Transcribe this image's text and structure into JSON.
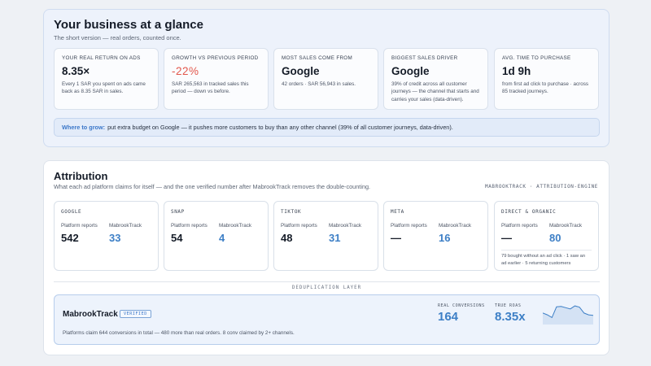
{
  "glance": {
    "title": "Your business at a glance",
    "subtitle": "The short version — real orders, counted once.",
    "kpis": [
      {
        "label": "Your real return on ads",
        "value": "8.35×",
        "desc": "Every 1 SAR you spent on ads came back as 8.35 SAR in sales."
      },
      {
        "label": "Growth vs previous period",
        "value": "-22%",
        "desc": "SAR 265,563 in tracked sales this period — down vs before."
      },
      {
        "label": "Most sales come from",
        "value": "Google",
        "desc": "42 orders · SAR 56,943 in sales."
      },
      {
        "label": "Biggest sales driver",
        "value": "Google",
        "desc": "39% of credit across all customer journeys — the channel that starts and carries your sales (data-driven)."
      },
      {
        "label": "Avg. time to purchase",
        "value": "1d 9h",
        "desc": "from first ad click to purchase · across 85 tracked journeys."
      }
    ],
    "grow": {
      "lead": "Where to grow:",
      "text": "put extra budget on Google — it pushes more customers to buy than any other channel (39% of all customer journeys, data-driven)."
    }
  },
  "attribution": {
    "title": "Attribution",
    "subtitle": "What each ad platform claims for itself — and the one verified number after MabrookTrack removes the double-counting.",
    "engine_label": "MABROOKTRACK · ATTRIBUTION-ENGINE",
    "col_platform": "Platform reports",
    "col_mabrook": "MabrookTrack",
    "platforms": [
      {
        "name": "GOOGLE",
        "platform": "542",
        "mabrook": "33"
      },
      {
        "name": "SNAP",
        "platform": "54",
        "mabrook": "4"
      },
      {
        "name": "TIKTOK",
        "platform": "48",
        "mabrook": "31"
      },
      {
        "name": "META",
        "platform": "—",
        "mabrook": "16"
      },
      {
        "name": "DIRECT & ORGANIC",
        "platform": "—",
        "mabrook": "80",
        "note": "79 bought without an ad click · 1 saw an ad earlier · 5 returning customers"
      }
    ],
    "dedup_label": "DEDUPLICATION LAYER",
    "card": {
      "brand": "MabrookTrack",
      "badge": "VERIFIED",
      "summary": "Platforms claim 644 conversions in total — 480 more than real orders. 8 conv claimed by 2+ channels.",
      "real_label": "REAL CONVERSIONS",
      "real_value": "164",
      "roas_label": "TRUE ROAS",
      "roas_value": "8.35x"
    },
    "sparkline": [
      0.55,
      0.45,
      0.3,
      0.9,
      0.92,
      0.85,
      0.78,
      0.95,
      0.88,
      0.55,
      0.45,
      0.42
    ]
  },
  "colors": {
    "accent": "#3d7fc6",
    "negative": "#e2574c",
    "text": "#151c28"
  }
}
